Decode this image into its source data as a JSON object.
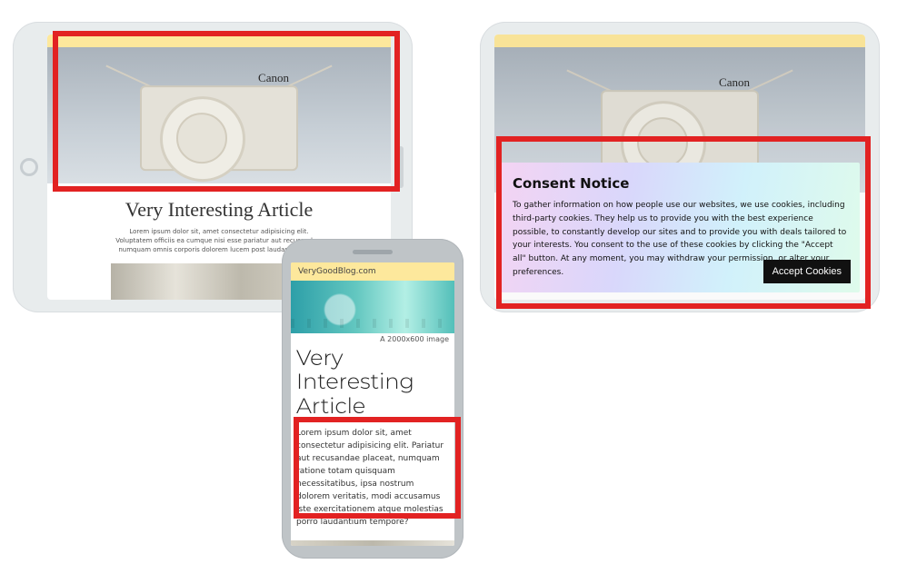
{
  "highlight_color": "#e22222",
  "tablet_left": {
    "hero_brand": "Canon",
    "article_title": "Very Interesting Article",
    "lorem_short": "Lorem ipsum dolor sit, amet consectetur adipisicing elit. Voluptatem officiis ea cumque nisi esse pariatur aut recusandae, numquam omnis corporis dolorem lucem post laudantium odit."
  },
  "tablet_right": {
    "hero_brand": "Canon",
    "consent_heading": "Consent Notice",
    "consent_body": "To gather information on how people use our websites, we use cookies, including third-party cookies. They help us to provide you with the best experience possible, to constantly develop our sites and to provide you with deals tailored to your interests. You consent to the use of these cookies by clicking the \"Accept all\" button. At any moment, you may withdraw your permission, or alter your preferences.",
    "accept_label": "Accept Cookies"
  },
  "phone": {
    "site_name": "VeryGoodBlog.com",
    "banner_caption": "A 2000x600 image",
    "article_title": "Very Interesting Article",
    "lorem": "Lorem ipsum dolor sit, amet consectetur adipisicing elit. Pariatur aut recusandae placeat, numquam ratione totam quisquam necessitatibus, ipsa nostrum dolorem veritatis, modi accusamus iste exercitationem atque molestias porro laudantium tempore?"
  }
}
